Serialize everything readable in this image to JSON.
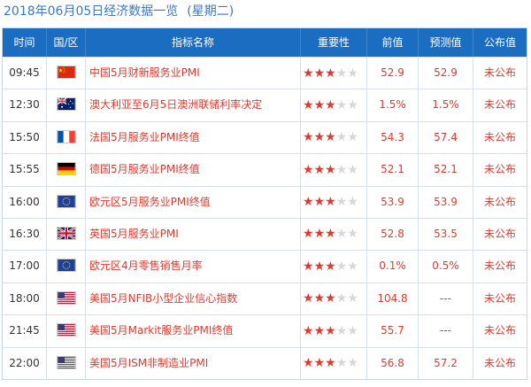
{
  "title": {
    "date_text": "2018年06月05日经济数据一览",
    "weekday": "(星期二)"
  },
  "header": {
    "time": "时间",
    "region": "国/区",
    "indicator": "指标名称",
    "importance": "重要性",
    "previous": "前值",
    "forecast": "预测值",
    "actual": "公布值"
  },
  "colors": {
    "header_bg": "#1b6dc1",
    "accent_red": "#e03a2f",
    "title_blue": "#3a78c8"
  },
  "rows": [
    {
      "time": "09:45",
      "flag": "china-flag-icon",
      "name": "中国5月财新服务业PMI",
      "stars": 3,
      "previous": "52.9",
      "forecast": "52.9",
      "actual": "未公布"
    },
    {
      "time": "12:30",
      "flag": "australia-flag-icon",
      "name": "澳大利亚至6月5日澳洲联储利率决定",
      "stars": 3,
      "previous": "1.5%",
      "forecast": "1.5%",
      "actual": "未公布"
    },
    {
      "time": "15:50",
      "flag": "france-flag-icon",
      "name": "法国5月服务业PMI终值",
      "stars": 3,
      "previous": "54.3",
      "forecast": "57.4",
      "actual": "未公布"
    },
    {
      "time": "15:55",
      "flag": "germany-flag-icon",
      "name": "德国5月服务业PMI终值",
      "stars": 3,
      "previous": "52.1",
      "forecast": "52.1",
      "actual": "未公布"
    },
    {
      "time": "16:00",
      "flag": "eu-flag-icon",
      "name": "欧元区5月服务业PMI终值",
      "stars": 3,
      "previous": "53.9",
      "forecast": "53.9",
      "actual": "未公布"
    },
    {
      "time": "16:30",
      "flag": "uk-flag-icon",
      "name": "英国5月服务业PMI",
      "stars": 3,
      "previous": "52.8",
      "forecast": "53.5",
      "actual": "未公布"
    },
    {
      "time": "17:00",
      "flag": "eu-flag-icon",
      "name": "欧元区4月零售销售月率",
      "stars": 3,
      "previous": "0.1%",
      "forecast": "0.5%",
      "actual": "未公布"
    },
    {
      "time": "18:00",
      "flag": "usa-flag-icon",
      "name": "美国5月NFIB小型企业信心指数",
      "stars": 3,
      "previous": "104.8",
      "forecast": "---",
      "actual": "未公布"
    },
    {
      "time": "21:45",
      "flag": "usa-flag-icon",
      "name": "美国5月Markit服务业PMI终值",
      "stars": 3,
      "previous": "55.7",
      "forecast": "---",
      "actual": "未公布"
    },
    {
      "time": "22:00",
      "flag": "usa-flag-icon",
      "name": "美国5月ISM非制造业PMI",
      "stars": 3,
      "previous": "56.8",
      "forecast": "57.2",
      "actual": "未公布"
    }
  ]
}
